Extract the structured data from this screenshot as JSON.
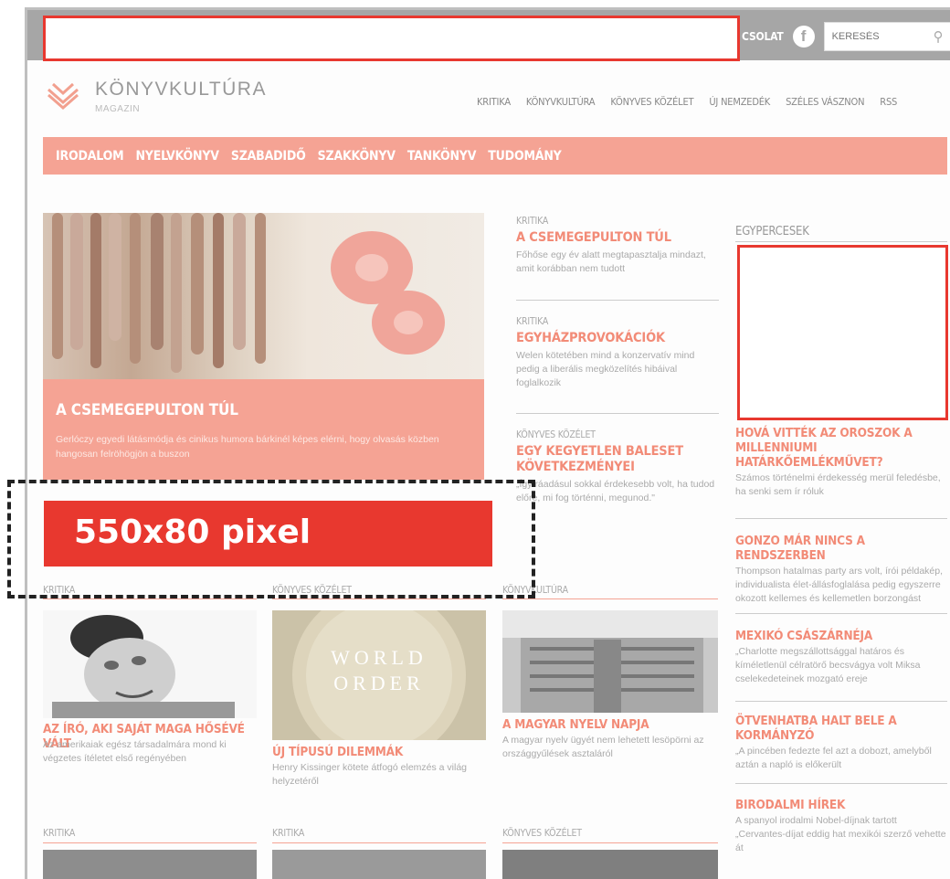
{
  "header": {
    "top_link": "CSOLAT",
    "facebook_glyph": "f",
    "search_placeholder": "KERESÉS",
    "search_icon": "search-icon"
  },
  "logo": {
    "name": "KÖNYVKULTÚRA",
    "sub": "MAGAZIN"
  },
  "main_nav": [
    "KRITIKA",
    "KÖNYVKULTÚRA",
    "KÖNYVES KÖZÉLET",
    "ÚJ NEMZEDÉK",
    "SZÉLES VÁSZNON",
    "RSS"
  ],
  "category_nav": [
    "IRODALOM",
    "NYELVKÖNYV",
    "SZABADIDŐ",
    "SZAKKÖNYV",
    "TANKÖNYV",
    "TUDOMÁNY"
  ],
  "hero": {
    "title": "A CSEMEGEPULTON TÚL",
    "desc": "Gerlóczy egyedi látásmódja és cinikus humora bárkinél képes elérni, hogy olvasás közben hangosan felröhögjön a buszon"
  },
  "mid_articles": [
    {
      "kicker": "KRITIKA",
      "title": "A CSEMEGEPULTON TÚL",
      "desc": "Főhőse egy év alatt megtapasztalja mindazt, amit korábban nem tudott"
    },
    {
      "kicker": "KRITIKA",
      "title": "EGYHÁZPROVOKÁCIÓK",
      "desc": "Welen kötetében mind a konzervatív mind pedig a liberális megközelítés hibáival foglalkozik"
    },
    {
      "kicker": "KÖNYVES KÖZÉLET",
      "title": "EGY KEGYETLEN BALESET KÖVETKEZMÉNYEI",
      "desc": "„Így ráadásul sokkal érdekesebb volt, ha tudod előre, mi fog történni, megunod.\""
    }
  ],
  "sidebar": {
    "heading": "EGYPERCESEK",
    "items": [
      {
        "title": "HOVÁ VITTÉK AZ OROSZOK A MILLENNIUMI HATÁRKŐEMLÉKMŰVET?",
        "desc": "Számos történelmi érdekesség merül feledésbe, ha senki sem ír róluk"
      },
      {
        "title": "GONZO MÁR NINCS A RENDSZERBEN",
        "desc": "Thompson hatalmas party ars volt, írói példakép, individualista élet-állásfoglalása pedig egyszerre okozott kellemes és kellemetlen borzongást"
      },
      {
        "title": "MEXIKÓ CSÁSZÁRNÉJA",
        "desc": "„Charlotte megszállottsággal határos és kíméletlenül célratörő becsvágya volt Miksa cselekedeteinek mozgató ereje"
      },
      {
        "title": "ÖTVENHATBA HALT BELE A KORMÁNYZÓ",
        "desc": "„A pincében fedezte fel azt a dobozt, amelyből aztán a napló is előkerült"
      },
      {
        "title": "BIRODALMI HÍREK",
        "desc": "A spanyol irodalmi Nobel-díjnak tartott „Cervantes-díjat eddig hat mexikói szerző vehette át"
      }
    ]
  },
  "banner_label": "550x80 pixel",
  "grid": [
    {
      "label": "KRITIKA",
      "title": "AZ ÍRÓ, AKI SAJÁT MAGA HŐSÉVÉ VÁLT",
      "desc": "Az amerikaiak egész társadalmára mond ki végzetes ítéletet első regényében"
    },
    {
      "label": "KÖNYVES KÖZÉLET",
      "title": "ÚJ TÍPUSÚ DILEMMÁK",
      "desc": "Henry Kissinger kötete átfogó elemzés a világ helyzetéről"
    },
    {
      "label": "KÖNYVKULTÚRA",
      "title": "A MAGYAR NYELV NAPJA",
      "desc": "A magyar nyelv ügyét nem lehetett lesöpörni az országgyűlések asztaláról"
    }
  ],
  "world_order_text": [
    "WORLD",
    "ORDER"
  ],
  "row3_labels": [
    "KRITIKA",
    "KRITIKA",
    "KÖNYVES KÖZÉLET"
  ],
  "colors": {
    "accent": "#f5a394",
    "red": "#e8382f",
    "grey": "#a6a6a6"
  }
}
